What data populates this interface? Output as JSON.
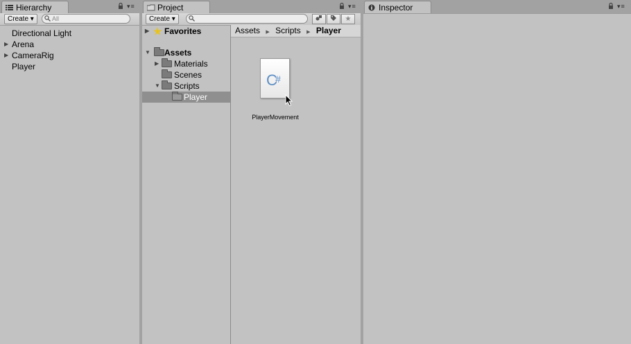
{
  "hierarchy": {
    "tab_label": "Hierarchy",
    "create_label": "Create",
    "search_placeholder": "All",
    "items": [
      {
        "label": "Directional Light"
      },
      {
        "label": "Arena"
      },
      {
        "label": "CameraRig"
      },
      {
        "label": "Player"
      }
    ]
  },
  "project": {
    "tab_label": "Project",
    "create_label": "Create",
    "tree": {
      "favorites": "Favorites",
      "assets": "Assets",
      "folders": [
        "Materials",
        "Scenes",
        "Scripts",
        "Player"
      ]
    },
    "breadcrumb": [
      "Assets",
      "Scripts",
      "Player"
    ],
    "files": [
      {
        "name": "PlayerMovement",
        "badge": "C#"
      }
    ]
  },
  "inspector": {
    "tab_label": "Inspector"
  },
  "icons": {
    "hierarchy_tab": "list-icon",
    "project_tab": "folder-icon",
    "inspector_tab": "info-icon",
    "favorites": "star-icon"
  },
  "colors": {
    "panel_bg": "#c2c2c2",
    "selection": "#8f8f8f",
    "cs_blue": "#5d8ec4",
    "favorite_star": "#e8c320"
  }
}
